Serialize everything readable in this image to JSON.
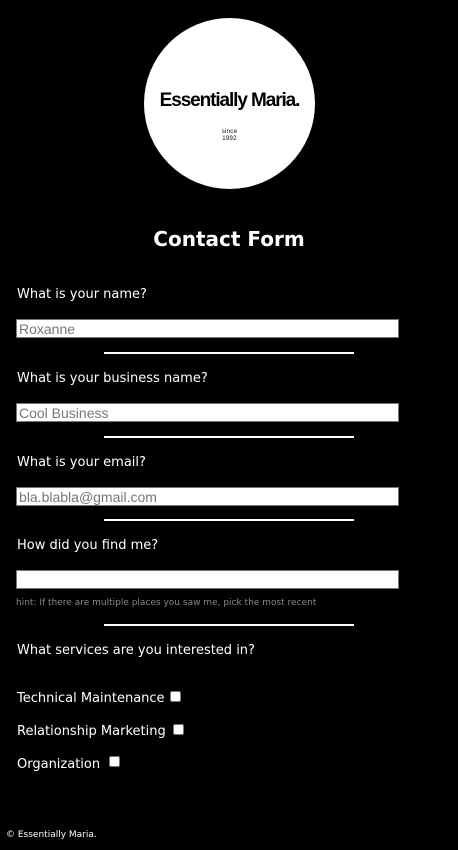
{
  "logo": {
    "name": "Essentially Maria.",
    "since_label": "since",
    "since_year": "1992"
  },
  "form": {
    "title": "Contact Form",
    "name": {
      "label": "What is your name?",
      "placeholder": "Roxanne"
    },
    "business": {
      "label": "What is your business name?",
      "placeholder": "Cool Business"
    },
    "email": {
      "label": "What is your email?",
      "placeholder": "bla.blabla@gmail.com"
    },
    "found": {
      "label": "How did you find me?",
      "placeholder": "",
      "hint": "hint: If there are multiple places you saw me, pick the most recent"
    },
    "services": {
      "label": "What services are you interested in?",
      "options": [
        {
          "label": "Technical Maintenance",
          "checked": false
        },
        {
          "label": "Relationship Marketing",
          "checked": false
        },
        {
          "label": "Organization",
          "checked": false
        }
      ]
    }
  },
  "footer": {
    "text": "© Essentially Maria."
  }
}
